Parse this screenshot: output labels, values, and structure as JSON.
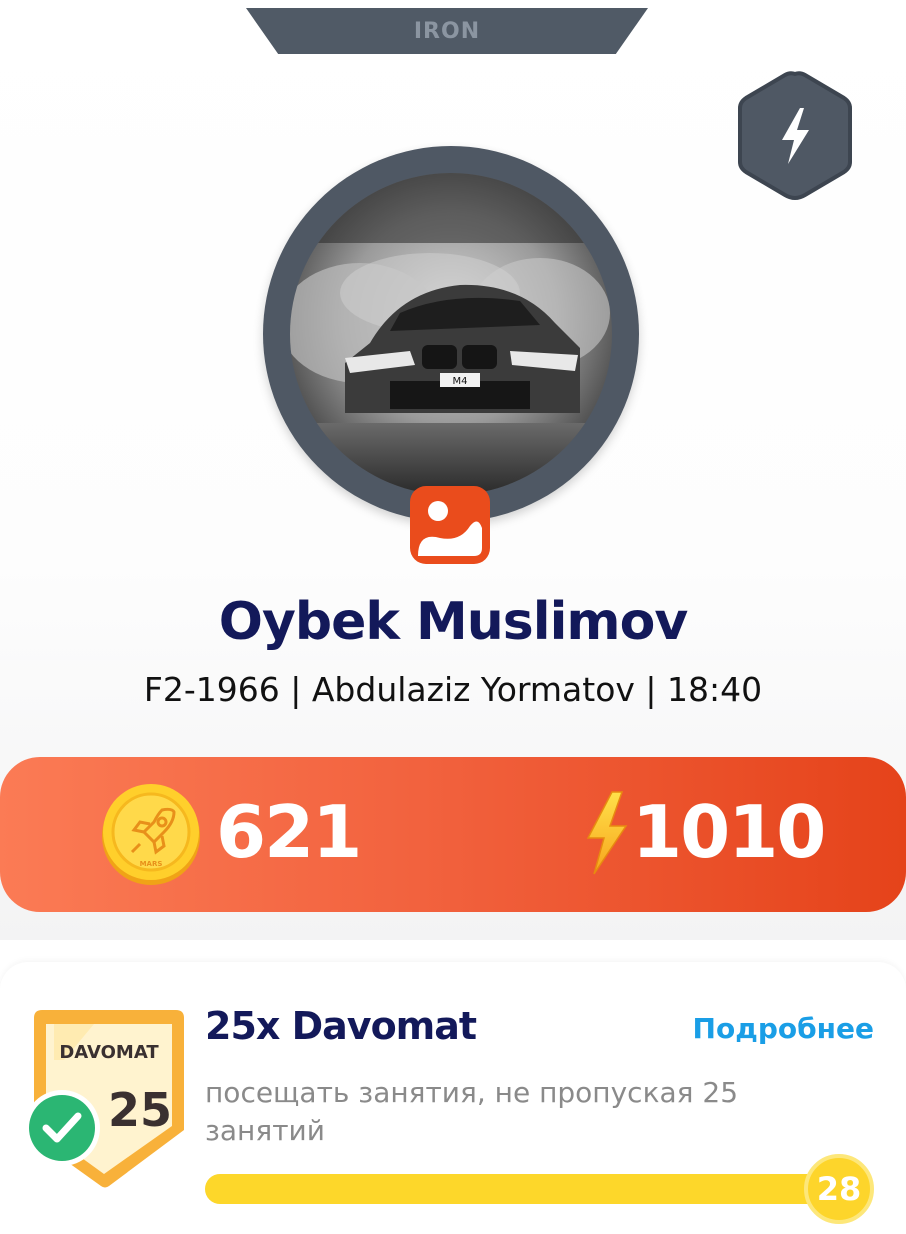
{
  "rank": {
    "label": "IRON"
  },
  "profile": {
    "name": "Oybek Muslimov",
    "meta": "F2-1966 | Abdulaziz Yormatov | 18:40",
    "photo_icon": "car-photo"
  },
  "stats": {
    "coins": "621",
    "coin_icon": "rocket-coin-icon",
    "energy": "1010",
    "energy_icon": "lightning-icon"
  },
  "achievement": {
    "badge_label": "DAVOMAT",
    "badge_number": "25",
    "title": "25x Davomat",
    "more_link": "Подробнее",
    "description": "посещать занятия, не пропуская 25 занятий",
    "progress_value": "28",
    "progress_fraction": 1.0
  },
  "colors": {
    "accent_orange": "#f1603c",
    "name_navy": "#13195a",
    "link_blue": "#1a9ee6",
    "progress_yellow": "#fdd72a",
    "ring_slate": "#4f5864",
    "check_green": "#2bb673"
  }
}
